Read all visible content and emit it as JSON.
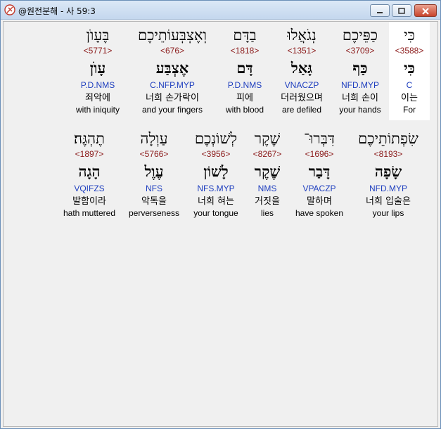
{
  "window": {
    "title": "@원전분해 - 사 59:3",
    "minimize_symbol": "–",
    "maximize_symbol": "▢",
    "close_symbol": "✕"
  },
  "verse": {
    "row1": [
      {
        "hebrew": "כִּי",
        "strong": "<3588>",
        "lemma": "כִּי",
        "morph": "C",
        "korean": "이는",
        "english": "For"
      },
      {
        "hebrew": "כַפֵּיכֶם",
        "strong": "<3709>",
        "lemma": "כַּף",
        "morph": "NFD.MYP",
        "korean": "너희 손이",
        "english": "your hands"
      },
      {
        "hebrew": "נְגֹאֲלוּ",
        "strong": "<1351>",
        "lemma": "גָּאַל",
        "morph": "VNACZP",
        "korean": "더러웠으며",
        "english": "are defiled"
      },
      {
        "hebrew": "בַדָּם",
        "strong": "<1818>",
        "lemma": "דָּם",
        "morph": "P.D.NMS",
        "korean": "피에",
        "english": "with blood"
      },
      {
        "hebrew": "וְאֶצְבְּעוֹתֵיכֶם",
        "strong": "<676>",
        "lemma": "אֶצְבַּע",
        "morph": "C.NFP.MYP",
        "korean": "너희 손가락이",
        "english": "and your fingers"
      },
      {
        "hebrew": "בֶּעָוֺן",
        "strong": "<5771>",
        "lemma": "עָוֺן",
        "morph": "P.D.NMS",
        "korean": "죄악에",
        "english": "with iniquity"
      }
    ],
    "row2": [
      {
        "hebrew": "שִׂפְתוֹתֵיכֶם",
        "strong": "<8193>",
        "lemma": "שָׂפָה",
        "morph": "NFD.MYP",
        "korean": "너희 입술은",
        "english": "your lips"
      },
      {
        "hebrew": "דִּבְּרוּ־",
        "strong": "<1696>",
        "lemma": "דָּבַר",
        "morph": "VPACZP",
        "korean": "말하며",
        "english": "have spoken"
      },
      {
        "hebrew": "שֶׁקֶר",
        "strong": "<8267>",
        "lemma": "שֶׁקֶר",
        "morph": "NMS",
        "korean": "거짓을",
        "english": "lies"
      },
      {
        "hebrew": "לְשׁוֹנְכֶם",
        "strong": "<3956>",
        "lemma": "לָשׁוֹן",
        "morph": "NFS.MYP",
        "korean": "너희 혀는",
        "english": "your tongue"
      },
      {
        "hebrew": "עַוְלָה",
        "strong": "<5766>",
        "lemma": "עֶוֶל",
        "morph": "NFS",
        "korean": "악독을",
        "english": "perverseness"
      },
      {
        "hebrew": "תֶהְגֶּה׃",
        "strong": "<1897>",
        "lemma": "הָגָה",
        "morph": "VQIFZS",
        "korean": "발함이라",
        "english": "hath muttered"
      }
    ]
  }
}
